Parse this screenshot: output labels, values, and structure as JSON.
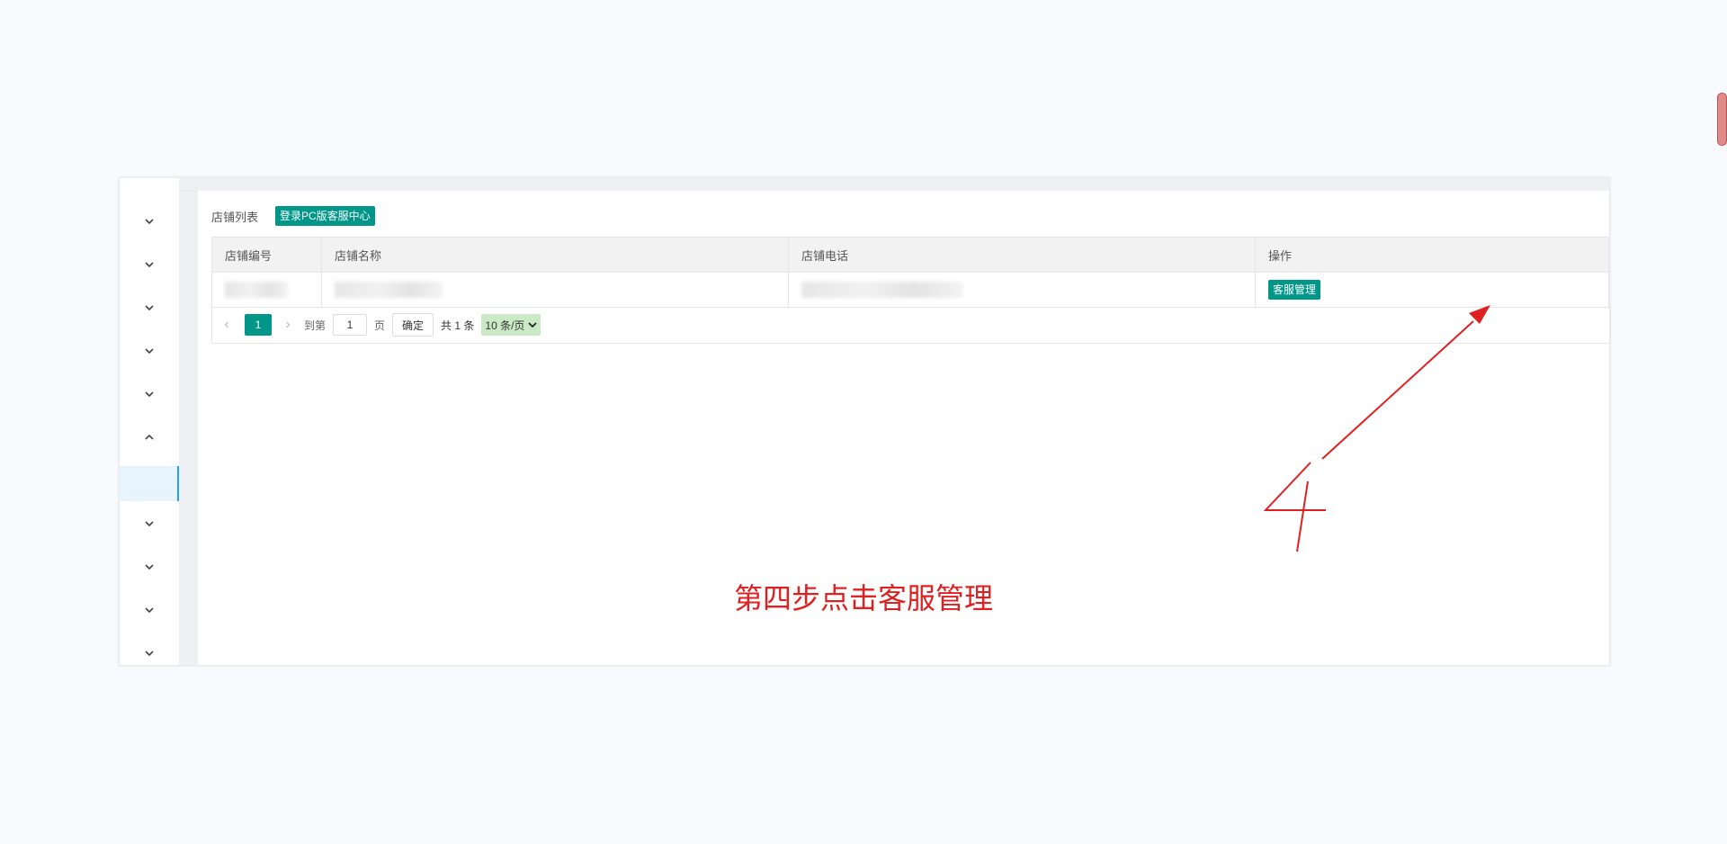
{
  "toolbar": {
    "title": "店铺列表",
    "login_button": "登录PC版客服中心"
  },
  "table": {
    "headers": [
      "店铺编号",
      "店铺名称",
      "店铺电话",
      "操作"
    ],
    "rows": [
      {
        "action_label": "客服管理"
      }
    ]
  },
  "pagination": {
    "prev": "‹",
    "current_page": "1",
    "next": "›",
    "goto_label": "到第",
    "page_input": "1",
    "page_label": "页",
    "confirm": "确定",
    "total": "共 1 条",
    "page_size": "10 条/页"
  },
  "annotation": {
    "text": "第四步点击客服管理",
    "step_number": "4",
    "color": "#e02020"
  },
  "colors": {
    "primary": "#009688",
    "accent_blue": "#1e9fff"
  },
  "icons": {
    "sidebar_collapsed": "chevron-down-icon",
    "sidebar_expanded": "chevron-up-icon"
  }
}
